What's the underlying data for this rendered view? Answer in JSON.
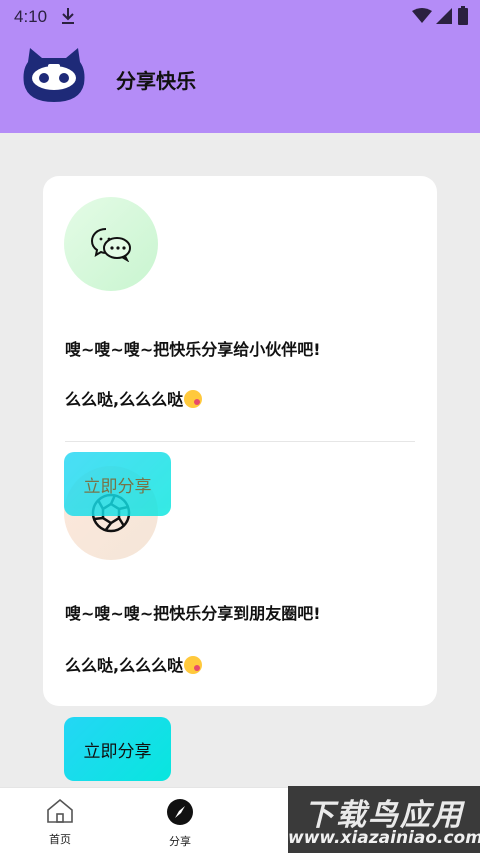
{
  "status_bar": {
    "time": "4:10"
  },
  "header": {
    "title": "分享快乐"
  },
  "share_wechat": {
    "title": "嗖~嗖~嗖~把快乐分享给小伙伴吧!",
    "subtitle": "么么哒,么么么哒"
  },
  "share_moments": {
    "title": "嗖~嗖~嗖~把快乐分享到朋友圈吧!",
    "subtitle": "么么哒,么么么哒"
  },
  "buttons": {
    "share_label": "立即分享"
  },
  "bottom_nav": {
    "items": [
      {
        "label": "首页",
        "icon": "home-icon"
      },
      {
        "label": "分享",
        "icon": "compass-icon"
      }
    ]
  },
  "watermark": {
    "title": "下载鸟应用",
    "url": "www.xiazainiao.com"
  },
  "colors": {
    "header_bg": "#b48cf7",
    "button_gradient_start": "#24d6f5",
    "button_gradient_end": "#08e6de"
  }
}
